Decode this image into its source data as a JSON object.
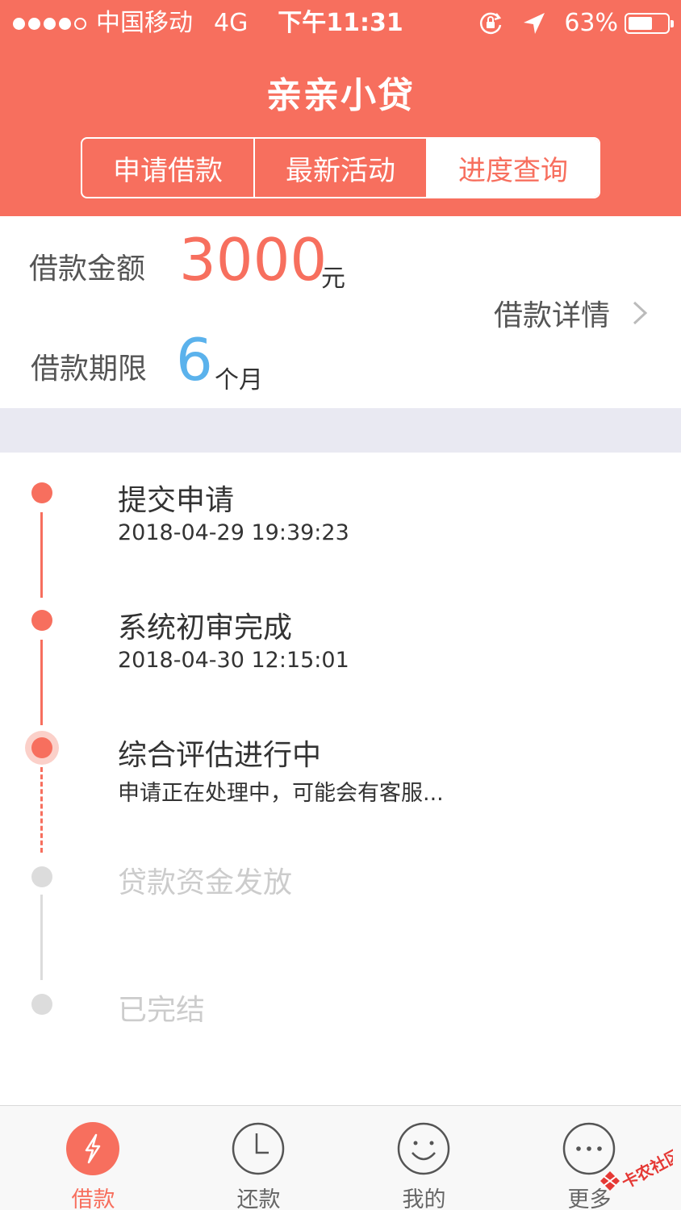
{
  "status_bar": {
    "carrier": "中国移动",
    "network": "4G",
    "time": "下午11:31",
    "battery": "63%",
    "battery_level": 0.63
  },
  "header": {
    "title": "亲亲小贷",
    "tabs": [
      {
        "label": "申请借款",
        "active": false
      },
      {
        "label": "最新活动",
        "active": false
      },
      {
        "label": "进度查询",
        "active": true
      }
    ]
  },
  "loan": {
    "amount_label": "借款金额",
    "amount_value": "3000",
    "amount_unit": "元",
    "term_label": "借款期限",
    "term_value": "6",
    "term_unit": "个月",
    "detail_link": "借款详情"
  },
  "timeline": [
    {
      "title": "提交申请",
      "sub": "2018-04-29 19:39:23",
      "state": "done"
    },
    {
      "title": "系统初审完成",
      "sub": "2018-04-30 12:15:01",
      "state": "done"
    },
    {
      "title": "综合评估进行中",
      "sub": "申请正在处理中，可能会有客服...",
      "state": "current"
    },
    {
      "title": "贷款资金发放",
      "sub": "",
      "state": "pending"
    },
    {
      "title": "已完结",
      "sub": "",
      "state": "pending"
    }
  ],
  "tabbar": {
    "items": [
      {
        "label": "借款",
        "icon": "lightning-icon",
        "active": true
      },
      {
        "label": "还款",
        "icon": "clock-icon",
        "active": false
      },
      {
        "label": "我的",
        "icon": "smiley-icon",
        "active": false
      },
      {
        "label": "更多",
        "icon": "more-icon",
        "active": false
      }
    ]
  },
  "watermark": {
    "label": "卡农社区"
  },
  "colors": {
    "brand": "#f76f5e",
    "accent_blue": "#5bb2ec",
    "pending": "#cccccc"
  }
}
